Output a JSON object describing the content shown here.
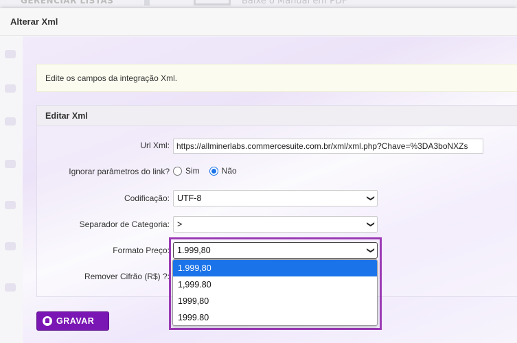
{
  "background": {
    "left_text": "GERENCIAR LISTAS",
    "right_text": "Baixe o Manual em PDF"
  },
  "modal": {
    "title": "Alterar Xml",
    "notice": "Edite os campos da integração Xml.",
    "panel_title": "Editar Xml"
  },
  "form": {
    "url": {
      "label": "Url Xml:",
      "value": "https://allminerlabs.commercesuite.com.br/xml/xml.php?Chave=%3DA3boNXZs"
    },
    "ignorar": {
      "label": "Ignorar parâmetros do link?",
      "options": [
        "Sim",
        "Não"
      ],
      "selected": "Não"
    },
    "codificacao": {
      "label": "Codificação:",
      "value": "UTF-8"
    },
    "separador": {
      "label": "Separador de Categoria:",
      "value": ">"
    },
    "formato": {
      "label": "Formato Preço:",
      "value": "1.999,80",
      "options": [
        "1.999,80",
        "1,999.80",
        "1999,80",
        "1999.80"
      ],
      "highlighted_index": 0
    },
    "remover": {
      "label": "Remover Cifrão (R$) ?:"
    }
  },
  "actions": {
    "save_label": "GRAVAR"
  },
  "colors": {
    "accent": "#7a16b3",
    "selection": "#1a73e8",
    "highlight_border": "#9b3ab5"
  },
  "icons": {
    "save": "user-circle-icon",
    "chevron": "chevron-down-icon"
  }
}
